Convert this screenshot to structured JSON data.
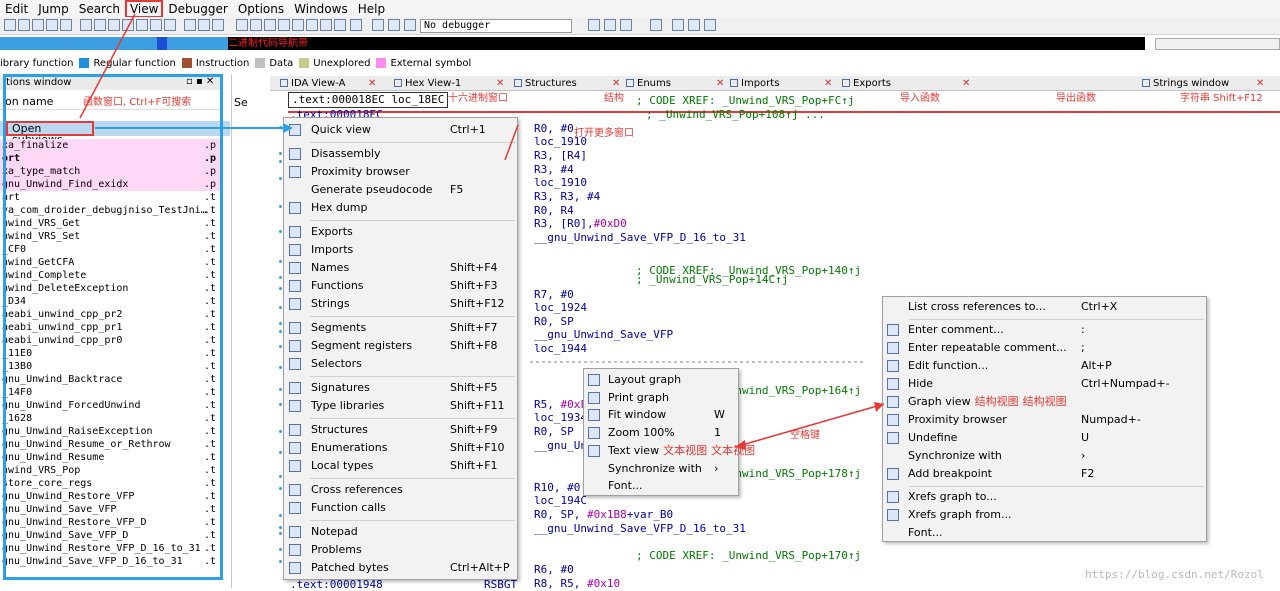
{
  "menubar": {
    "items": [
      "Edit",
      "Jump",
      "Search",
      "View",
      "Debugger",
      "Options",
      "Windows",
      "Help"
    ]
  },
  "toolbar": {
    "debugger_select": "No debugger"
  },
  "nav": {
    "annotation": "二进制代码导航带"
  },
  "legend": [
    {
      "label": "ibrary function",
      "color": "#7ec9f5"
    },
    {
      "label": "Regular function",
      "color": "#1f8fe0"
    },
    {
      "label": "Instruction",
      "color": "#a0522d"
    },
    {
      "label": "Data",
      "color": "#c0c0c0"
    },
    {
      "label": "Unexplored",
      "color": "#c8c88a"
    },
    {
      "label": "External symbol",
      "color": "#ff8cf0"
    }
  ],
  "function_panel": {
    "title": "tions window",
    "header": "ion name",
    "header_annotation": "函数窗口, Ctrl+F可搜索",
    "segment_header": "Se",
    "open_subviews": "Open subviews",
    "rows": [
      {
        "name": "xa_finalize",
        "seg": ".p",
        "style": "pink"
      },
      {
        "name": "ort",
        "seg": ".p",
        "style": "pink-bold"
      },
      {
        "name": "xa_type_match",
        "seg": ".p",
        "style": "pink"
      },
      {
        "name": "gnu_Unwind_Find_exidx",
        "seg": ".p",
        "style": "pink"
      },
      {
        "name": "art",
        "seg": ".t",
        "style": ""
      },
      {
        "name": "va_com_droider_debugjniso_TestJni…",
        "seg": ".t",
        "style": ""
      },
      {
        "name": "nwind_VRS_Get",
        "seg": ".t",
        "style": ""
      },
      {
        "name": "nwind_VRS_Set",
        "seg": ".t",
        "style": ""
      },
      {
        "name": "_CF0",
        "seg": ".t",
        "style": ""
      },
      {
        "name": "nwind_GetCFA",
        "seg": ".t",
        "style": ""
      },
      {
        "name": "nwind_Complete",
        "seg": ".t",
        "style": ""
      },
      {
        "name": "nwind_DeleteException",
        "seg": ".t",
        "style": ""
      },
      {
        "name": "_D34",
        "seg": ".t",
        "style": ""
      },
      {
        "name": "aeabi_unwind_cpp_pr2",
        "seg": ".t",
        "style": ""
      },
      {
        "name": "aeabi_unwind_cpp_pr1",
        "seg": ".t",
        "style": ""
      },
      {
        "name": "aeabi_unwind_cpp_pr0",
        "seg": ".t",
        "style": ""
      },
      {
        "name": "_11E0",
        "seg": ".t",
        "style": ""
      },
      {
        "name": "_13B0",
        "seg": ".t",
        "style": ""
      },
      {
        "name": "gnu_Unwind_Backtrace",
        "seg": ".t",
        "style": ""
      },
      {
        "name": "_14F0",
        "seg": ".t",
        "style": ""
      },
      {
        "name": "gnu_Unwind_ForcedUnwind",
        "seg": ".t",
        "style": ""
      },
      {
        "name": "_1628",
        "seg": ".t",
        "style": ""
      },
      {
        "name": "gnu_Unwind_RaiseException",
        "seg": ".t",
        "style": ""
      },
      {
        "name": "gnu_Unwind_Resume_or_Rethrow",
        "seg": ".t",
        "style": ""
      },
      {
        "name": "gnu_Unwind_Resume",
        "seg": ".t",
        "style": ""
      },
      {
        "name": "nwind_VRS_Pop",
        "seg": ".t",
        "style": ""
      },
      {
        "name": "store_core_regs",
        "seg": ".t",
        "style": ""
      },
      {
        "name": "gnu_Unwind_Restore_VFP",
        "seg": ".t",
        "style": ""
      },
      {
        "name": "gnu_Unwind_Save_VFP",
        "seg": ".t",
        "style": ""
      },
      {
        "name": "gnu_Unwind_Restore_VFP_D",
        "seg": ".t",
        "style": ""
      },
      {
        "name": "gnu_Unwind_Save_VFP_D",
        "seg": ".t",
        "style": ""
      },
      {
        "name": "gnu_Unwind_Restore_VFP_D_16_to_31",
        "seg": ".t",
        "style": ""
      },
      {
        "name": "gnu_Unwind_Save_VFP_D_16_to_31",
        "seg": ".t",
        "style": ""
      }
    ]
  },
  "tabs": [
    {
      "label": "IDA View-A",
      "annotation": "十六进制窗口"
    },
    {
      "label": "Hex View-1",
      "annotation": ""
    },
    {
      "label": "Structures",
      "annotation": "结构"
    },
    {
      "label": "Enums",
      "annotation": ""
    },
    {
      "label": "Imports",
      "annotation": "导入函数"
    },
    {
      "label": "Exports",
      "annotation": "导出函数"
    },
    {
      "label": "Strings window",
      "annotation": "字符串 Shift+F12"
    }
  ],
  "code": {
    "addr_line": ".text:000018EC loc_18EC",
    "addr_line2": ".text:000018EC",
    "bottom_addr": ".text:00001948",
    "bottom_op": "RSBGT",
    "xref1": "; CODE XREF: _Unwind_VRS_Pop+FC↑j",
    "xref1b": "; _Unwind_VRS_Pop+108↑j ...",
    "open_more_annot": "打开更多窗口",
    "lines": [
      "R0, #0",
      "loc_1910",
      "R3, [R4]",
      "R3, #4",
      "loc_1910",
      "R3, R3, #4",
      "R0, R4",
      "R3, [R0],#0xD0",
      "__gnu_Unwind_Save_VFP_D_16_to_31",
      "; CODE XREF: _Unwind_VRS_Pop+140↑j",
      "; _Unwind_VRS_Pop+14C↑j",
      "R7, #0",
      "loc_1924",
      "R0, SP",
      "__gnu_Unwind_Save_VFP",
      "loc_1944",
      "; CODE XREF: _Unwind_VRS_Pop+164↑j",
      "R5, #0xF",
      "loc_1934",
      "R0, SP",
      "__gnu_Unw",
      "; CODE XREF: _Unwind_VRS_Pop+178↑j",
      "R10, #0",
      "loc_194C",
      "R0, SP, #0x1B8+var_B0",
      "__gnu_Unwind_Save_VFP_D_16_to_31",
      "; CODE XREF: _Unwind_VRS_Pop+170↑j",
      "R6, #0",
      "R8, R5, #0x10"
    ]
  },
  "menu_subviews": {
    "items": [
      {
        "label": "Quick view",
        "key": "Ctrl+1",
        "icon": "quick-view-icon"
      },
      {
        "sep": true
      },
      {
        "label": "Disassembly",
        "key": "",
        "icon": "disassembly-icon"
      },
      {
        "label": "Proximity browser",
        "key": "",
        "icon": "proximity-icon"
      },
      {
        "label": "Generate pseudocode",
        "key": "F5",
        "icon": ""
      },
      {
        "label": "Hex dump",
        "key": "",
        "icon": "hex-dump-icon"
      },
      {
        "sep": true
      },
      {
        "label": "Exports",
        "key": "",
        "icon": "exports-icon"
      },
      {
        "label": "Imports",
        "key": "",
        "icon": "imports-icon"
      },
      {
        "label": "Names",
        "key": "Shift+F4",
        "icon": "names-icon"
      },
      {
        "label": "Functions",
        "key": "Shift+F3",
        "icon": "functions-icon"
      },
      {
        "label": "Strings",
        "key": "Shift+F12",
        "icon": "strings-icon"
      },
      {
        "sep": true
      },
      {
        "label": "Segments",
        "key": "Shift+F7",
        "icon": "segments-icon"
      },
      {
        "label": "Segment registers",
        "key": "Shift+F8",
        "icon": "segment-registers-icon"
      },
      {
        "label": "Selectors",
        "key": "",
        "icon": "selectors-icon"
      },
      {
        "sep": true
      },
      {
        "label": "Signatures",
        "key": "Shift+F5",
        "icon": "signatures-icon"
      },
      {
        "label": "Type libraries",
        "key": "Shift+F11",
        "icon": "type-libraries-icon"
      },
      {
        "sep": true
      },
      {
        "label": "Structures",
        "key": "Shift+F9",
        "icon": "structures-icon"
      },
      {
        "label": "Enumerations",
        "key": "Shift+F10",
        "icon": "enumerations-icon"
      },
      {
        "label": "Local types",
        "key": "Shift+F1",
        "icon": "local-types-icon"
      },
      {
        "sep": true
      },
      {
        "label": "Cross references",
        "key": "",
        "icon": "cross-references-icon"
      },
      {
        "label": "Function calls",
        "key": "",
        "icon": "function-calls-icon"
      },
      {
        "sep": true
      },
      {
        "label": "Notepad",
        "key": "",
        "icon": "notepad-icon"
      },
      {
        "label": "Problems",
        "key": "",
        "icon": "problems-icon"
      },
      {
        "label": "Patched bytes",
        "key": "Ctrl+Alt+P",
        "icon": "patched-bytes-icon"
      }
    ]
  },
  "menu_graph": {
    "items": [
      {
        "label": "Layout graph",
        "key": "",
        "icon": "layout-graph-icon"
      },
      {
        "label": "Print graph",
        "key": "",
        "icon": "print-graph-icon"
      },
      {
        "label": "Fit window",
        "key": "W",
        "icon": "fit-window-icon"
      },
      {
        "label": "Zoom 100%",
        "key": "1",
        "icon": "zoom-icon"
      },
      {
        "label": "Text view",
        "key": "",
        "icon": "text-view-icon",
        "note": "文本视图"
      },
      {
        "label": "Synchronize with",
        "key": "›",
        "icon": ""
      },
      {
        "label": "Font...",
        "key": "",
        "icon": ""
      }
    ],
    "space_annotation": "空格键"
  },
  "menu_context": {
    "items": [
      {
        "label": "List cross references to...",
        "key": "Ctrl+X",
        "icon": ""
      },
      {
        "sep": true
      },
      {
        "label": "Enter comment...",
        "key": ":",
        "icon": "comment-icon"
      },
      {
        "label": "Enter repeatable comment...",
        "key": ";",
        "icon": "repeatable-comment-icon"
      },
      {
        "label": "Edit function...",
        "key": "Alt+P",
        "icon": "edit-function-icon"
      },
      {
        "label": "Hide",
        "key": "Ctrl+Numpad+-",
        "icon": "hide-icon"
      },
      {
        "label": "Graph view",
        "key": "",
        "icon": "graph-view-icon",
        "note": "结构视图"
      },
      {
        "label": "Proximity browser",
        "key": "Numpad+-",
        "icon": "proximity-icon"
      },
      {
        "label": "Undefine",
        "key": "U",
        "icon": "undefine-icon"
      },
      {
        "label": "Synchronize with",
        "key": "›",
        "icon": ""
      },
      {
        "label": "Add breakpoint",
        "key": "F2",
        "icon": "add-breakpoint-icon"
      },
      {
        "sep": true
      },
      {
        "label": "Xrefs graph to...",
        "key": "",
        "icon": "xrefs-to-icon"
      },
      {
        "label": "Xrefs graph from...",
        "key": "",
        "icon": "xrefs-from-icon"
      },
      {
        "label": "Font...",
        "key": "",
        "icon": ""
      }
    ]
  },
  "watermark": "https://blog.csdn.net/Rozol"
}
